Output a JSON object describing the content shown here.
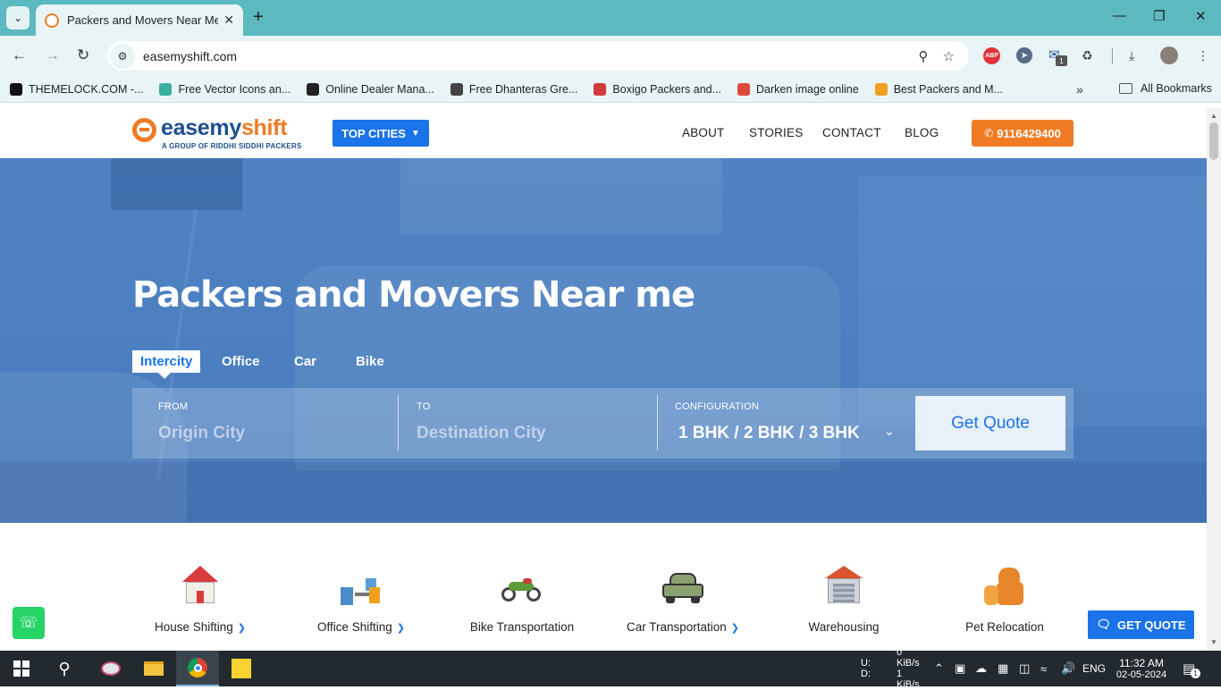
{
  "browser": {
    "tab_title": "Packers and Movers Near Me, H",
    "url": "easemyshift.com",
    "tab_menu_icon": "chevron-down-icon",
    "extensions": [
      "ABP"
    ],
    "extension_badge": "1",
    "bookmarks": [
      {
        "label": "THEMELOCK.COM -...",
        "color": "#111111"
      },
      {
        "label": "Free Vector Icons an...",
        "color": "#3ab0a0"
      },
      {
        "label": "Online Dealer Mana...",
        "color": "#222222"
      },
      {
        "label": "Free Dhanteras Gre...",
        "color": "#444444"
      },
      {
        "label": "Boxigo Packers and...",
        "color": "#d23a3a"
      },
      {
        "label": "Darken image online",
        "color": "#e04a3a"
      },
      {
        "label": "Best Packers and M...",
        "color": "#f0a020"
      }
    ],
    "all_bookmarks": "All Bookmarks"
  },
  "header": {
    "logo_text_a": "easemy",
    "logo_text_b": "shift",
    "logo_tagline": "A GROUP OF RIDDHI SIDDHI PACKERS",
    "top_cities": "TOP CITIES",
    "nav": [
      "ABOUT",
      "STORIES",
      "CONTACT",
      "BLOG"
    ],
    "phone": "9116429400"
  },
  "hero": {
    "title": "Packers and Movers Near me",
    "modes": [
      "Intercity",
      "Office",
      "Car",
      "Bike"
    ],
    "active_mode": "Intercity",
    "from_label": "FROM",
    "from_placeholder": "Origin City",
    "to_label": "TO",
    "to_placeholder": "Destination City",
    "config_label": "CONFIGURATION",
    "config_value": "1 BHK / 2 BHK / 3 BHK",
    "get_quote": "Get Quote"
  },
  "services": [
    {
      "label": "House Shifting",
      "arrow": true
    },
    {
      "label": "Office Shifting",
      "arrow": true
    },
    {
      "label": "Bike Transportation",
      "arrow": false
    },
    {
      "label": "Car Transportation",
      "arrow": true
    },
    {
      "label": "Warehousing",
      "arrow": false
    },
    {
      "label": "Pet Relocation",
      "arrow": false
    }
  ],
  "floating": {
    "get_quote": "GET QUOTE"
  },
  "taskbar": {
    "net_up_label": "U:",
    "net_down_label": "D:",
    "net_up": "0 KiB/s",
    "net_down": "1 KiB/s",
    "lang": "ENG",
    "time": "11:32 AM",
    "date": "02-05-2024",
    "notif_count": "1"
  },
  "colors": {
    "accent": "#1a73e8",
    "brand_orange": "#f07b24",
    "hero_blue": "#4f82c2"
  }
}
